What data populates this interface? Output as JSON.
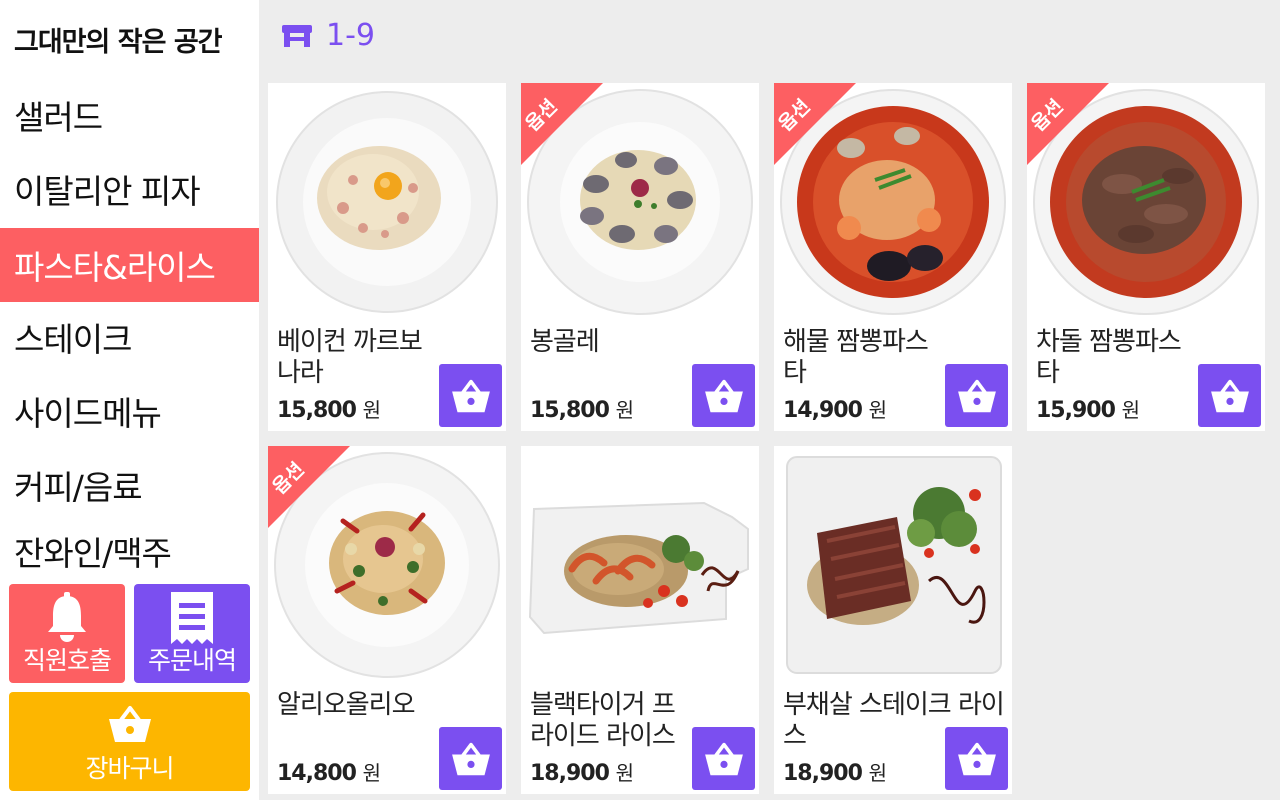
{
  "store": {
    "name": "그대만의 작은 공간"
  },
  "table": {
    "number": "1-9"
  },
  "categories": [
    {
      "label": "샐러드"
    },
    {
      "label": "이탈리안 피자"
    },
    {
      "label": "파스타&라이스"
    },
    {
      "label": "스테이크"
    },
    {
      "label": "사이드메뉴"
    },
    {
      "label": "커피/음료"
    },
    {
      "label": "잔와인/맥주"
    }
  ],
  "active_category": "파스타&라이스",
  "actions": {
    "call_label": "직원호출",
    "history_label": "주문내역",
    "cart_label": "장바구니"
  },
  "option_badge": "옵션",
  "currency": "원",
  "menu": [
    {
      "name": "베이컨 까르보나라",
      "price": "15,800",
      "option": false
    },
    {
      "name": "봉골레",
      "price": "15,800",
      "option": true
    },
    {
      "name": "해물 짬뽕파스타",
      "price": "14,900",
      "option": true
    },
    {
      "name": "차돌 짬뽕파스타",
      "price": "15,900",
      "option": true
    },
    {
      "name": "알리오올리오",
      "price": "14,800",
      "option": true
    },
    {
      "name": "블랙타이거 프라이드 라이스",
      "price": "18,900",
      "option": false
    },
    {
      "name": "부채살 스테이크 라이스",
      "price": "18,900",
      "option": false
    }
  ],
  "colors": {
    "accent_red": "#fd5f62",
    "accent_purple": "#7b4ff0",
    "accent_yellow": "#fdb600",
    "background": "#ededed"
  },
  "icons": {
    "table": "table-icon",
    "bell": "bell-icon",
    "receipt": "receipt-icon",
    "basket": "basket-icon"
  }
}
